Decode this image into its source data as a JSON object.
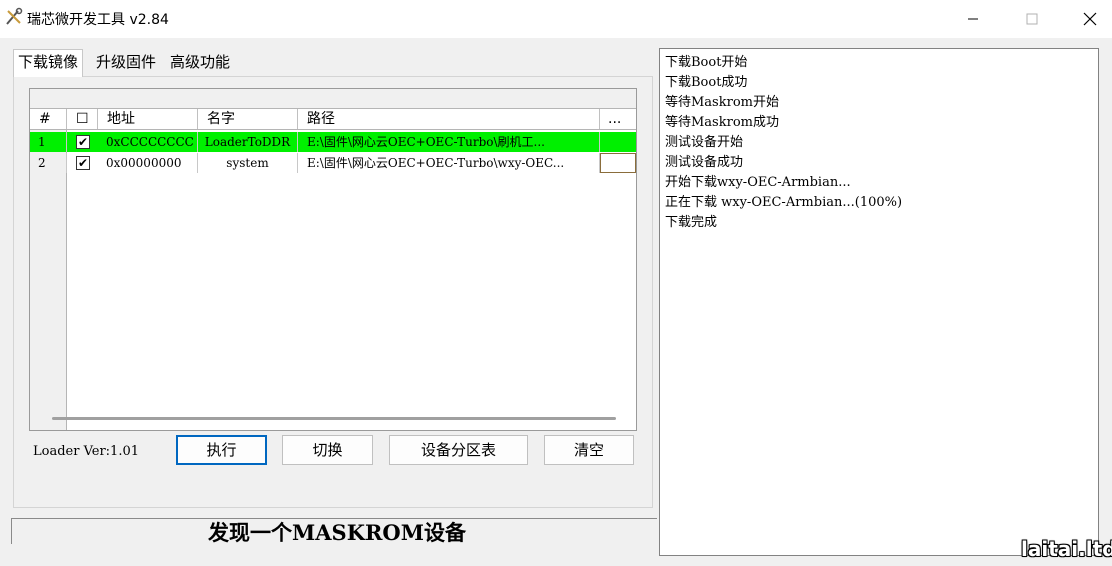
{
  "window": {
    "title": "瑞芯微开发工具 v2.84",
    "icon": "tools-icon",
    "controls": [
      "minimize-icon",
      "maximize-icon",
      "close-icon"
    ]
  },
  "tabs": [
    {
      "label": "下载镜像",
      "active": true
    },
    {
      "label": "升级固件",
      "active": false
    },
    {
      "label": "高级功能",
      "active": false
    }
  ],
  "grid": {
    "headers": [
      "#",
      "☐",
      "地址",
      "名字",
      "路径",
      "..."
    ],
    "rows": [
      {
        "index": "1",
        "checked": "✔",
        "address": "0xCCCCCCCC",
        "name": "LoaderToDDR",
        "path": "E:\\固件\\网心云OEC+OEC-Turbo\\刷机工...",
        "highlight": "#00f000"
      },
      {
        "index": "2",
        "checked": "✔",
        "address": "0x00000000",
        "name": "system",
        "path": "E:\\固件\\网心云OEC+OEC-Turbo\\wxy-OEC...",
        "highlight": "#ffffff"
      }
    ]
  },
  "loader_version": "Loader Ver:1.01",
  "buttons": {
    "execute": "执行",
    "switch": "切换",
    "partition_table": "设备分区表",
    "clear": "清空"
  },
  "status": "发现一个MASKROM设备",
  "log": [
    "下载Boot开始",
    "下载Boot成功",
    "等待Maskrom开始",
    "等待Maskrom成功",
    "测试设备开始",
    "测试设备成功",
    "开始下载wxy-OEC-Armbian...",
    "正在下载 wxy-OEC-Armbian...(100%)",
    "下载完成"
  ],
  "watermark": "laitai.ltd",
  "colors": {
    "selected_row": "#00f000",
    "focus_border": "#0067c0"
  }
}
